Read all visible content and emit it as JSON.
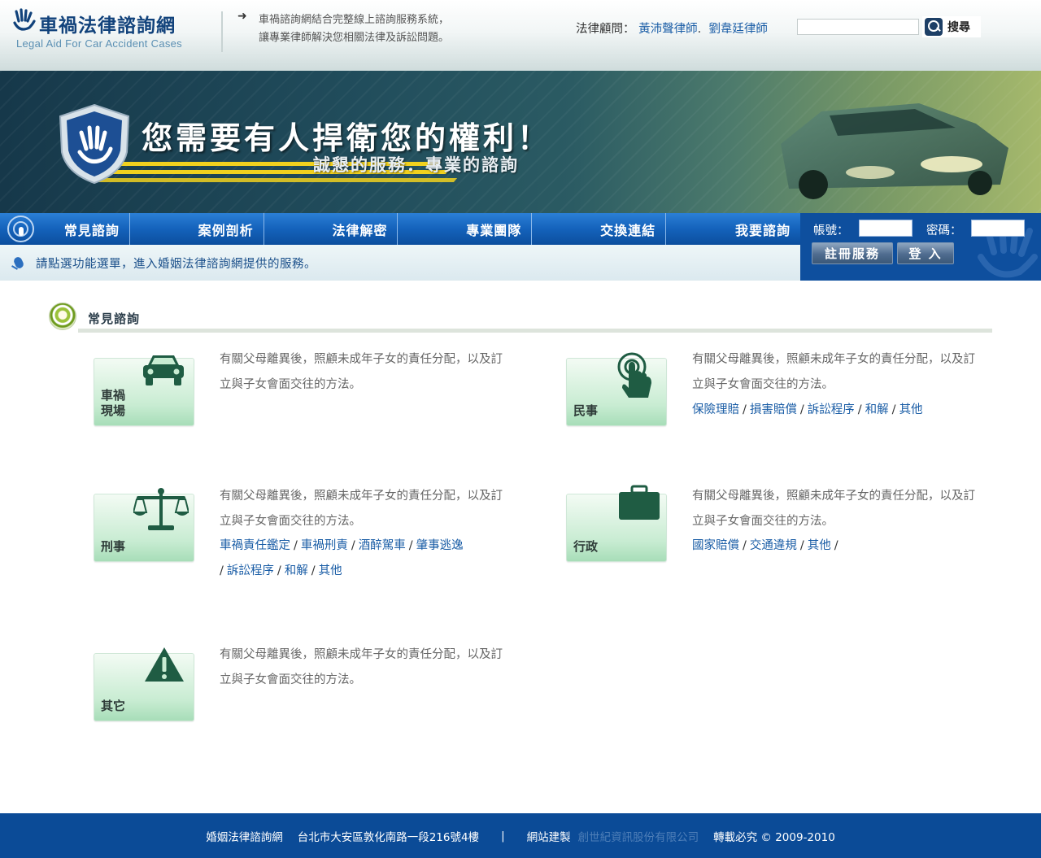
{
  "header": {
    "logo_title": "車禍法律諮詢網",
    "logo_sub": "Legal Aid For Car Accident Cases",
    "slogan_line1": "車禍諮詢網結合完整線上諮詢服務系統，",
    "slogan_line2": "讓專業律師解決您相關法律及訴訟問題。",
    "advisor_label": "法律顧問：",
    "advisor_1": "黃沛聲律師",
    "advisor_sep": ".",
    "advisor_2": "劉韋廷律師",
    "search_value": "",
    "search_label": "搜尋"
  },
  "banner": {
    "headline": "您需要有人捍衛您的權利！",
    "subline": "誠懇的服務．專業的諮詢"
  },
  "nav": {
    "items": [
      {
        "label": "常見諮詢"
      },
      {
        "label": "案例剖析"
      },
      {
        "label": "法律解密"
      },
      {
        "label": "專業團隊"
      },
      {
        "label": "交換連結"
      },
      {
        "label": "我要諮詢"
      }
    ]
  },
  "breadcrumb": {
    "text": "請點選功能選單，進入婚姻法律諮詢網提供的服務。"
  },
  "login": {
    "account_label": "帳號：",
    "password_label": "密碼：",
    "account_value": "",
    "password_value": "",
    "register_label": "註冊服務",
    "login_label": "登 入"
  },
  "section": {
    "title": "常見諮詢"
  },
  "cards": [
    {
      "label": "車禍\n現場",
      "label_line1": "車禍",
      "label_line2": "現場",
      "icon": "car-icon",
      "desc": "有關父母離異後，照顧未成年子女的責任分配，以及訂立與子女會面交往的方法。",
      "links": []
    },
    {
      "label": "民事",
      "icon": "touch-hand-icon",
      "desc": "有關父母離異後，照顧未成年子女的責任分配，以及訂立與子女會面交往的方法。",
      "links": [
        "保險理賠",
        "損害賠償",
        "訴訟程序",
        "和解",
        "其他"
      ]
    },
    {
      "label": "刑事",
      "icon": "scales-icon",
      "desc": "有關父母離異後，照顧未成年子女的責任分配，以及訂立與子女會面交往的方法。",
      "links": [
        "車禍責任鑑定",
        "車禍刑責",
        "酒醉駕車",
        "肇事逃逸",
        "訴訟程序",
        "和解",
        "其他"
      ]
    },
    {
      "label": "行政",
      "icon": "briefcase-icon",
      "desc": "有關父母離異後，照顧未成年子女的責任分配，以及訂立與子女會面交往的方法。",
      "links": [
        "國家賠償",
        "交通違規",
        "其他"
      ]
    },
    {
      "label": "其它",
      "icon": "warning-icon",
      "desc": "有關父母離異後，照顧未成年子女的責任分配，以及訂立與子女會面交往的方法。",
      "links": []
    }
  ],
  "footer": {
    "site": "婚姻法律諮詢網",
    "address": "台北市大安區敦化南路一段216號4樓",
    "divider": "|",
    "builder_label": "網站建製",
    "builder": "創世紀資訊股份有限公司",
    "copyright": "轉載必究 © 2009-2010"
  },
  "colors": {
    "brand_blue": "#0b4b97",
    "link_blue": "#1a5da6",
    "tile_green": "#c8ecd2",
    "icon_green": "#1f5c43"
  }
}
